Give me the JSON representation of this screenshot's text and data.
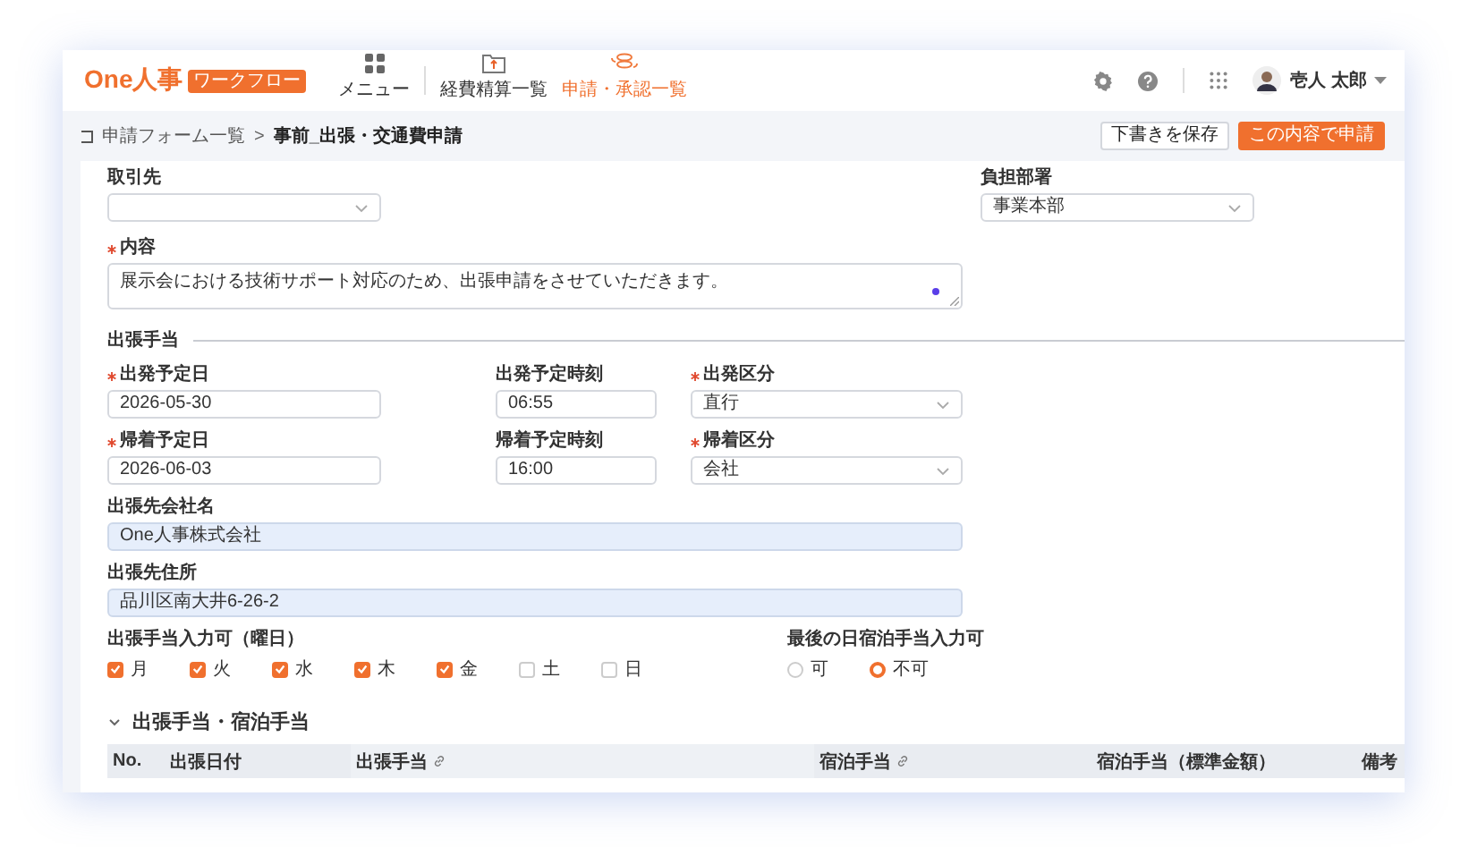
{
  "header": {
    "logo": {
      "text": "One人事",
      "badge": "ワークフロー"
    },
    "nav": [
      {
        "label": "メニュー",
        "selected": false
      },
      {
        "label": "経費精算一覧",
        "selected": false
      },
      {
        "label": "申請・承認一覧",
        "selected": true
      }
    ],
    "user": {
      "name": "壱人 太郎"
    }
  },
  "breadcrumb": {
    "items": [
      "申請フォーム一覧",
      "事前_出張・交通費申請"
    ],
    "separator": ">"
  },
  "actions": [
    {
      "label": "下書きを保存",
      "kind": "secondary"
    },
    {
      "label": "この内容で申請",
      "kind": "primary"
    }
  ],
  "client": {
    "label": "取引先",
    "required": false
  },
  "department": {
    "label": "負担部署",
    "required": false,
    "value": "事業本部"
  },
  "content": {
    "label": "内容",
    "required": true,
    "value": "展示会における技術サポート対応のため、出張申請をさせていただきます。"
  },
  "trip": {
    "title": "出張手当",
    "departure_date": {
      "label": "出発予定日",
      "required": true,
      "value": "2026-05-30"
    },
    "departure_time": {
      "label": "出発予定時刻",
      "required": false,
      "value": "06:55"
    },
    "departure_type": {
      "label": "出発区分",
      "required": true,
      "value": "直行"
    },
    "return_date": {
      "label": "帰着予定日",
      "required": true,
      "value": "2026-06-03"
    },
    "return_time": {
      "label": "帰着予定時刻",
      "required": false,
      "value": "16:00"
    },
    "return_type": {
      "label": "帰着区分",
      "required": true,
      "value": "会社"
    },
    "company": {
      "label": "出張先会社名",
      "required": false,
      "value": "One人事株式会社"
    },
    "address": {
      "label": "出張先住所",
      "required": false,
      "value": "品川区南大井6-26-2"
    },
    "allowance_days": {
      "label": "出張手当入力可（曜日）",
      "options": [
        {
          "label": "月",
          "checked": true
        },
        {
          "label": "火",
          "checked": true
        },
        {
          "label": "水",
          "checked": true
        },
        {
          "label": "木",
          "checked": true
        },
        {
          "label": "金",
          "checked": true
        },
        {
          "label": "土",
          "checked": false
        },
        {
          "label": "日",
          "checked": false
        }
      ]
    },
    "last_day_lodging": {
      "label": "最後の日宿泊手当入力可",
      "options": [
        {
          "label": "可",
          "selected": false
        },
        {
          "label": "不可",
          "selected": true
        }
      ]
    }
  },
  "allowances": {
    "title": "出張手当・宿泊手当",
    "expanded": true,
    "columns": [
      {
        "label": "No.",
        "linked": false
      },
      {
        "label": "出張日付",
        "linked": false
      },
      {
        "label": "出張手当",
        "linked": true
      },
      {
        "label": "宿泊手当",
        "linked": true
      },
      {
        "label": "宿泊手当（標準金額）",
        "linked": false
      },
      {
        "label": "備考",
        "linked": false
      }
    ]
  }
}
